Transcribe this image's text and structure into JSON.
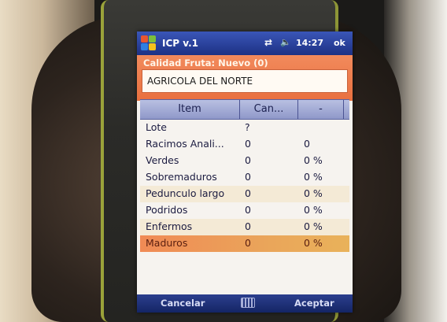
{
  "statusbar": {
    "app_title": "ICP v.1",
    "time": "14:27",
    "ok_label": "ok"
  },
  "form": {
    "title": "Calidad Fruta: Nuevo (0)",
    "company": "AGRICOLA DEL NORTE"
  },
  "grid": {
    "columns": [
      "Item",
      "Can...",
      "-"
    ],
    "rows": [
      {
        "item": "Lote",
        "count": "?",
        "percent": ""
      },
      {
        "item": "Racimos Anali...",
        "count": "0",
        "percent": "0"
      },
      {
        "item": "Verdes",
        "count": "0",
        "percent": "0 %"
      },
      {
        "item": "Sobremaduros",
        "count": "0",
        "percent": "0 %"
      },
      {
        "item": "Pedunculo largo",
        "count": "0",
        "percent": "0 %"
      },
      {
        "item": "Podridos",
        "count": "0",
        "percent": "0 %"
      },
      {
        "item": "Enfermos",
        "count": "0",
        "percent": "0 %"
      },
      {
        "item": "Maduros",
        "count": "0",
        "percent": "0 %"
      }
    ]
  },
  "softkeys": {
    "left": "Cancelar",
    "right": "Aceptar"
  },
  "icons": {
    "start": "windows-start-icon",
    "signal": "signal-icon",
    "volume": "speaker-muted-icon",
    "keyboard": "keyboard-icon"
  },
  "colors": {
    "titlebar": "#1d3184",
    "form_header": "#e8703f",
    "selected_row": "#f08a55"
  }
}
